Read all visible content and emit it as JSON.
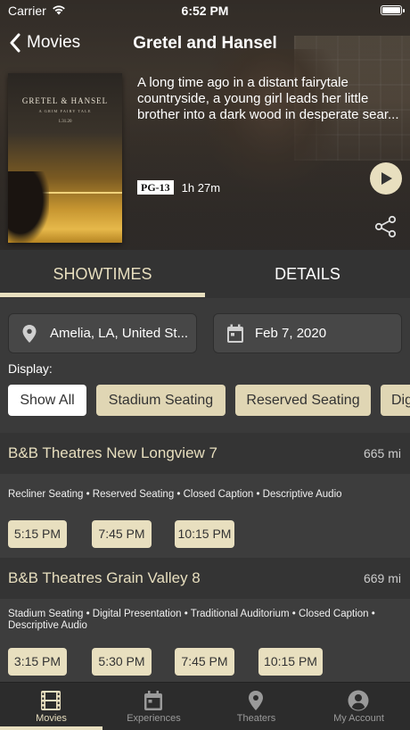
{
  "status_bar": {
    "carrier": "Carrier",
    "time": "6:52 PM"
  },
  "nav": {
    "back_label": "Movies",
    "title": "Gretel and Hansel"
  },
  "movie": {
    "poster": {
      "title": "GRETEL & HANSEL",
      "subtitle": "A GRIM FAIRY TALE",
      "date": "1.31.20"
    },
    "synopsis": "A long time ago in a distant fairytale countryside, a young girl leads her little brother into a dark wood in desperate sear...",
    "rating": "PG-13",
    "runtime": "1h 27m"
  },
  "tabs": {
    "showtimes": "SHOWTIMES",
    "details": "DETAILS"
  },
  "filters": {
    "location": "Amelia, LA, United St...",
    "date": "Feb 7, 2020",
    "display_label": "Display:",
    "chips": [
      "Show All",
      "Stadium Seating",
      "Reserved Seating",
      "Digital Presentation"
    ],
    "selected_chip": "Show All"
  },
  "theaters": [
    {
      "name": "B&B Theatres New Longview 7",
      "distance": "665 mi",
      "amenities": "Recliner Seating • Reserved Seating • Closed Caption • Descriptive Audio",
      "times": [
        "5:15 PM",
        "7:45 PM",
        "10:15 PM"
      ]
    },
    {
      "name": "B&B Theatres Grain Valley 8",
      "distance": "669 mi",
      "amenities": "Stadium Seating • Digital Presentation • Traditional Auditorium • Closed Caption • Descriptive Audio",
      "times": [
        "3:15 PM",
        "5:30 PM",
        "7:45 PM",
        "10:15 PM"
      ]
    }
  ],
  "tab_bar": [
    {
      "label": "Movies",
      "icon": "film-icon",
      "active": true
    },
    {
      "label": "Experiences",
      "icon": "calendar-icon",
      "active": false
    },
    {
      "label": "Theaters",
      "icon": "location-pin-icon",
      "active": false
    },
    {
      "label": "My Account",
      "icon": "account-icon",
      "active": false
    }
  ],
  "colors": {
    "accent": "#e8dfbf",
    "background": "#3a3a3a",
    "tab_bar": "#2c2c2c"
  }
}
